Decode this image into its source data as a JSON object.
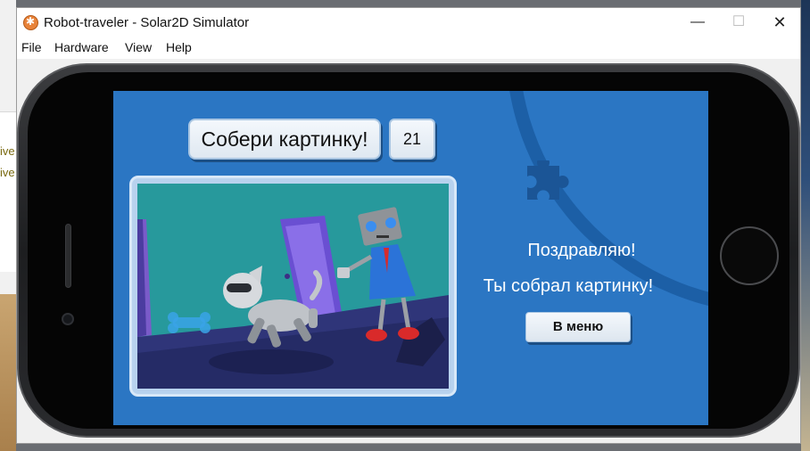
{
  "window": {
    "title": "Robot-traveler - Solar2D Simulator",
    "controls": {
      "minimize": "—",
      "maximize": "☐",
      "close": "✕"
    }
  },
  "menubar": {
    "items": [
      "File",
      "Hardware",
      "View",
      "Help"
    ]
  },
  "desktop": {
    "partial_text": [
      "ive",
      "ive"
    ]
  },
  "game": {
    "title_button": "Собери картинку!",
    "counter": "21",
    "congrats_line1": "Поздравляю!",
    "congrats_line2": "Ты собрал картинку!",
    "menu_button": "В меню"
  },
  "colors": {
    "screen_bg": "#2b76c3",
    "screen_arc": "#1c5fa6",
    "puzzle_icon": "#1b5596",
    "picture_bg": "#27999c"
  },
  "icons": [
    "app-icon",
    "puzzle-piece-icon"
  ]
}
